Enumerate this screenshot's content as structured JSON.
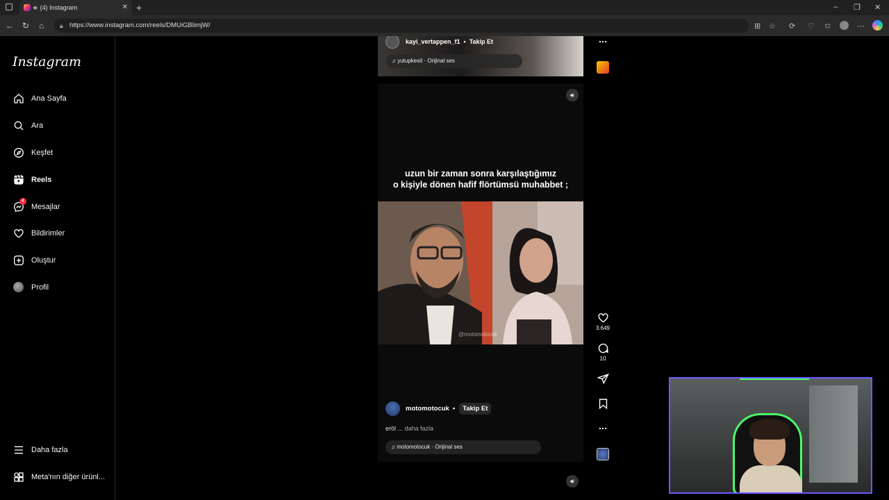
{
  "browser": {
    "tab_title": "(4) Instagram",
    "url": "https://www.instagram.com/reels/DMUiGBlimjW/"
  },
  "sidebar": {
    "logo": "Instagram",
    "items": [
      {
        "label": "Ana Sayfa",
        "icon": "home-icon"
      },
      {
        "label": "Ara",
        "icon": "search-icon"
      },
      {
        "label": "Keşfet",
        "icon": "compass-icon"
      },
      {
        "label": "Reels",
        "icon": "reels-icon",
        "active": true
      },
      {
        "label": "Mesajlar",
        "icon": "messenger-icon",
        "badge": "4"
      },
      {
        "label": "Bildirimler",
        "icon": "heart-icon"
      },
      {
        "label": "Oluştur",
        "icon": "plus-square-icon"
      },
      {
        "label": "Profil",
        "icon": "avatar"
      }
    ],
    "more": "Daha fazla",
    "meta": "Meta'nın diğer ürünl..."
  },
  "prev_reel": {
    "username": "kayi_vertappen_f1",
    "follow": "Takip Et",
    "audio": "yutupkesit · Orijinal ses"
  },
  "reel": {
    "caption_line1": "uzun bir zaman sonra karşılaştığımız",
    "caption_line2": "o kişiyle dönen hafif flörtümsü muhabbet ;",
    "watermark": "@motomotocuk",
    "username": "motomotocuk",
    "dot": "•",
    "follow": "Takip Et",
    "desc": "eröl ...",
    "more": "daha fazla",
    "audio": "motomotocuk · Orijinal ses",
    "likes": "3.649",
    "comments": "10"
  }
}
